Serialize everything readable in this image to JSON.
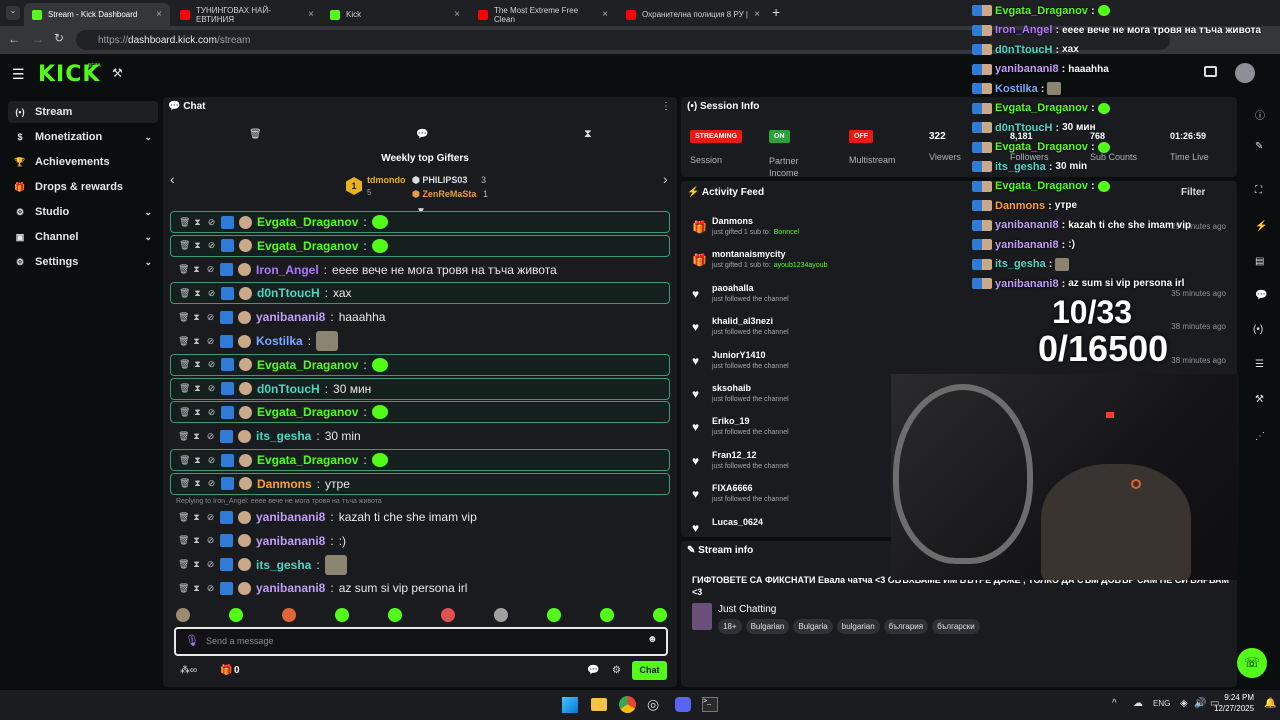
{
  "browser": {
    "tabs": [
      {
        "label": "Stream - Kick Dashboard",
        "color": "#53fc18",
        "active": true
      },
      {
        "label": "ТУНИНГОВАХ НАЙ-ЕВТИНИЯ",
        "color": "#ff0000"
      },
      {
        "label": "Kick",
        "color": "#53fc18"
      },
      {
        "label": "The Most Extreme Free Clean",
        "color": "#ff0000"
      },
      {
        "label": "Охранителна полиция 8 РУ |",
        "color": "#ff0000"
      }
    ],
    "url_host": "dashboard.kick.com",
    "url_path": "/stream",
    "url_prefix": "https://"
  },
  "header": {
    "logo": "KICK",
    "logo_badge": "BETA"
  },
  "sidebar": {
    "items": [
      {
        "label": "Stream",
        "icon": "stream-icon",
        "glyph": "(•)"
      },
      {
        "label": "Monetization",
        "icon": "dollar-icon",
        "glyph": "$",
        "chevron": true
      },
      {
        "label": "Achievements",
        "icon": "trophy-icon",
        "glyph": "🏆"
      },
      {
        "label": "Drops & rewards",
        "icon": "gift-icon",
        "glyph": "🎁"
      },
      {
        "label": "Studio",
        "icon": "gear-icon",
        "glyph": "⚙",
        "chevron": true
      },
      {
        "label": "Channel",
        "icon": "channel-icon",
        "glyph": "▣",
        "chevron": true
      },
      {
        "label": "Settings",
        "icon": "settings-icon",
        "glyph": "⚙",
        "chevron": true
      }
    ]
  },
  "chat": {
    "title": "Chat",
    "gifters_title": "Weekly top Gifters",
    "gifters": [
      {
        "rank": "1",
        "name": "tdmondo",
        "count": "5"
      },
      {
        "name": "PHILIPS03",
        "count": "3"
      },
      {
        "name": "ZenReMaSta",
        "count": "1"
      }
    ],
    "messages": [
      {
        "user": "Evgata_Draganov",
        "text": "",
        "color": "#53fc18",
        "hl": true,
        "emote": true
      },
      {
        "user": "Evgata_Draganov",
        "text": "",
        "color": "#53fc18",
        "hl": true,
        "emote": true
      },
      {
        "user": "Iron_Angel",
        "text": "ееее вече не мога тровя на тъча живота",
        "color": "#b277ff"
      },
      {
        "user": "d0nTtoucH",
        "text": "хах",
        "color": "#4cd6c6",
        "hl": true
      },
      {
        "user": "yanibanani8",
        "text": "haaahha",
        "color": "#c29cf7"
      },
      {
        "user": "Kostilka",
        "text": "",
        "color": "#7aa7ff",
        "img": true
      },
      {
        "user": "Evgata_Draganov",
        "text": "",
        "color": "#53fc18",
        "hl": true,
        "emote": true
      },
      {
        "user": "d0nTtoucH",
        "text": "30 мин",
        "color": "#4cd6c6",
        "hl": true
      },
      {
        "user": "Evgata_Draganov",
        "text": "",
        "color": "#53fc18",
        "hl": true,
        "emote": true
      },
      {
        "user": "its_gesha",
        "text": "30 min",
        "color": "#4cd6c6"
      },
      {
        "user": "Evgata_Draganov",
        "text": "",
        "color": "#53fc18",
        "hl": true,
        "emote": true
      },
      {
        "user": "Danmons",
        "text": "утре",
        "color": "#ff9f2e",
        "hl": true
      }
    ],
    "reply_note": "Replying to Iron_Angel: ееее вече не мога тровя на тъча живота",
    "messages2": [
      {
        "user": "yanibanani8",
        "text": "kazah ti che she imam vip",
        "color": "#c29cf7"
      },
      {
        "user": "yanibanani8",
        "text": ":)",
        "color": "#c29cf7"
      },
      {
        "user": "its_gesha",
        "text": "",
        "color": "#4cd6c6",
        "img": true
      },
      {
        "user": "yanibanani8",
        "text": "az sum si vip persona irl",
        "color": "#c29cf7"
      }
    ],
    "input_placeholder": "Send a message",
    "send_label": "Chat",
    "points": "0"
  },
  "session": {
    "title": "Session Info",
    "stats": [
      {
        "pill": "STREAMING",
        "pill_color": "#e91916",
        "label": "Session"
      },
      {
        "pill": "ON",
        "pill_color": "#2ba33a",
        "label": "Partner Income"
      },
      {
        "pill": "OFF",
        "pill_color": "#e91916",
        "label": "Multistream"
      }
    ],
    "viewers": {
      "value": "322",
      "label": "Viewers"
    },
    "followers": {
      "value": "8,181",
      "label": "Followers"
    },
    "subs": {
      "value": "768",
      "label": "Sub Counts"
    },
    "time": {
      "value": "01:26:59",
      "label": "Time Live"
    }
  },
  "activity": {
    "title": "Activity Feed",
    "filter": "Filter",
    "items": [
      {
        "user": "Danmons",
        "sub": "just gifted 1 sub to:",
        "target": "Bonncel",
        "time": "29 minutes ago",
        "type": "gift"
      },
      {
        "user": "montanaismycity",
        "sub": "just gifted 1 sub to:",
        "target": "ayoub1234ayoub",
        "time": "",
        "type": "gift"
      },
      {
        "user": "paoahalla",
        "sub": "just followed the channel",
        "time": "35 minutes ago",
        "type": "follow"
      },
      {
        "user": "khalid_al3nezi",
        "sub": "just followed the channel",
        "time": "38 minutes ago",
        "type": "follow"
      },
      {
        "user": "JuniorY1410",
        "sub": "just followed the channel",
        "time": "38 minutes ago",
        "type": "follow"
      },
      {
        "user": "sksohaib",
        "sub": "just followed the channel",
        "time": "",
        "type": "follow"
      },
      {
        "user": "Eriko_19",
        "sub": "just followed the channel",
        "time": "",
        "type": "follow"
      },
      {
        "user": "Fran12_12",
        "sub": "just followed the channel",
        "time": "",
        "type": "follow"
      },
      {
        "user": "FIXA6666",
        "sub": "just followed the channel",
        "time": "",
        "type": "follow"
      },
      {
        "user": "Lucas_0624",
        "sub": "",
        "time": "",
        "type": "follow"
      }
    ]
  },
  "stream_info": {
    "title": "Stream info",
    "stream_title": "ГИФТОВЕТЕ СА ФИКСНАТИ Евала чатча <3 ОБЪХВАМЕ ИМ ВЪТРЕ ДАЖЕ , ТОЛКО ДА СЪМ ДОВЪР САМ НЕ СИ ВЯРВАМ <3",
    "category": "Just Chatting",
    "tags": [
      "18+",
      "Bulgarian",
      "Bulgaria",
      "bulgarian",
      "българия",
      "български"
    ]
  },
  "overlay": {
    "counter1": "10/33",
    "counter2": "0/16500",
    "messages": [
      {
        "user": "Evgata_Draganov",
        "text": "",
        "color": "#53fc18",
        "emote": true
      },
      {
        "user": "Iron_Angel",
        "text": "ееее вече не мога тровя на тъча живота",
        "color": "#b277ff"
      },
      {
        "user": "d0nTtoucH",
        "text": "хах",
        "color": "#4cd6c6"
      },
      {
        "user": "yanibanani8",
        "text": "haaahha",
        "color": "#c29cf7"
      },
      {
        "user": "Kostilka",
        "text": "",
        "color": "#7aa7ff",
        "img": true
      },
      {
        "user": "Evgata_Draganov",
        "text": "",
        "color": "#53fc18",
        "emote": true
      },
      {
        "user": "d0nTtoucH",
        "text": "30 мин",
        "color": "#4cd6c6"
      },
      {
        "user": "Evgata_Draganov",
        "text": "",
        "color": "#53fc18",
        "emote": true
      },
      {
        "user": "its_gesha",
        "text": "30 min",
        "color": "#4cd6c6"
      },
      {
        "user": "Evgata_Draganov",
        "text": "",
        "color": "#53fc18",
        "emote": true
      },
      {
        "user": "Danmons",
        "text": "утре",
        "color": "#ff9f2e"
      },
      {
        "user": "yanibanani8",
        "text": "kazah ti che she imam vip",
        "color": "#c29cf7"
      },
      {
        "user": "yanibanani8",
        "text": ":)",
        "color": "#c29cf7"
      },
      {
        "user": "its_gesha",
        "text": "",
        "color": "#4cd6c6",
        "img": true
      },
      {
        "user": "yanibanani8",
        "text": "az sum si vip persona irl",
        "color": "#c29cf7"
      }
    ]
  },
  "taskbar": {
    "lang": "ENG",
    "time": "9:24 PM",
    "date": "12/27/2025"
  }
}
